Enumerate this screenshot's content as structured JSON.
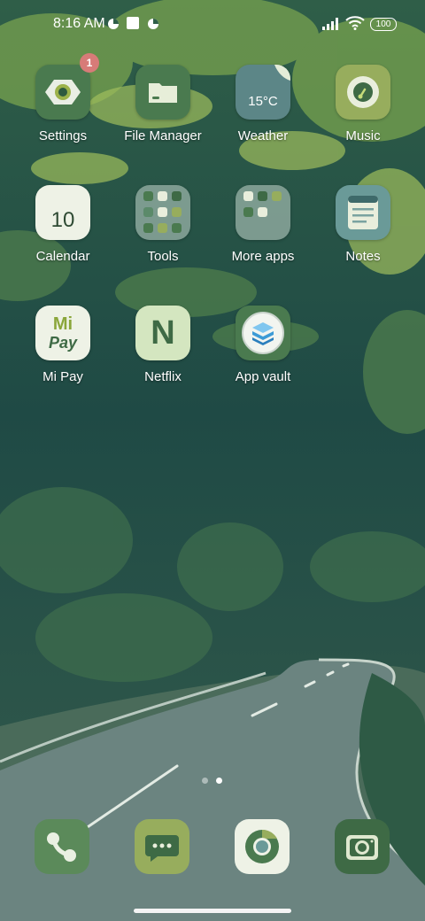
{
  "status_bar": {
    "time": "8:16 AM",
    "battery": "100",
    "icons": [
      "data-saver-icon",
      "square-notification-icon",
      "data-saver-icon",
      "signal-icon",
      "wifi-icon",
      "battery-icon"
    ]
  },
  "apps": [
    {
      "label": "Settings",
      "icon": "settings-gear-icon",
      "badge": "1"
    },
    {
      "label": "File Manager",
      "icon": "folder-icon"
    },
    {
      "label": "Weather",
      "icon": "weather-icon",
      "temperature": "15°C"
    },
    {
      "label": "Music",
      "icon": "music-disc-icon"
    },
    {
      "label": "Calendar",
      "icon": "calendar-icon",
      "day": "10"
    },
    {
      "label": "Tools",
      "icon": "folder-tools-icon"
    },
    {
      "label": "More apps",
      "icon": "folder-more-apps-icon"
    },
    {
      "label": "Notes",
      "icon": "notes-icon"
    },
    {
      "label": "Mi Pay",
      "icon": "mi-pay-icon",
      "logo_top": "Mi",
      "logo_bottom": "Pay"
    },
    {
      "label": "Netflix",
      "icon": "netflix-icon",
      "logo": "N"
    },
    {
      "label": "App vault",
      "icon": "app-vault-icon"
    }
  ],
  "dock": [
    {
      "name": "phone",
      "icon": "phone-icon"
    },
    {
      "name": "messages",
      "icon": "messages-icon"
    },
    {
      "name": "browser",
      "icon": "chrome-icon"
    },
    {
      "name": "camera",
      "icon": "camera-icon"
    }
  ],
  "pages": {
    "count": 2,
    "current": 2
  },
  "colors": {
    "icon_light": "#dfe8cf",
    "icon_mid": "#8fae6b",
    "icon_dark": "#3f6b46",
    "badge": "#d77b78"
  }
}
